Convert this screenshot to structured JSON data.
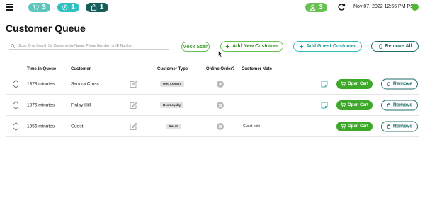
{
  "topbar": {
    "cart_count": "3",
    "pickup_count": "1",
    "bag_count": "1",
    "users_count": "3",
    "datetime": "Nov 07, 2022 12:56 PM PST",
    "colors": {
      "cart_pill": "#5cc6bd",
      "pickup_pill": "#2fc1c0",
      "bag_pill": "#175e5b",
      "users_pill": "#67c051",
      "status_dot": "#52b736"
    }
  },
  "page": {
    "title": "Customer Queue"
  },
  "toolbar": {
    "search_placeholder": "Scan ID or Search for Customer by Name, Phone Number, or ID Number",
    "mock_scan_label": "Mock Scan",
    "add_new_customer_label": "Add New Customer",
    "add_guest_customer_label": "Add Guest Customer",
    "remove_all_label": "Remove All"
  },
  "table": {
    "headers": {
      "time_in_queue": "Time in Queue",
      "customer": "Customer",
      "customer_type": "Customer Type",
      "online_order": "Online Order?",
      "customer_note": "Customer Note"
    },
    "rows": [
      {
        "time": "1378 minutes",
        "customer": "Sandra Cross",
        "type": "Med Loyalty",
        "note": "",
        "open_cart_label": "Open Cart",
        "remove_label": "Remove"
      },
      {
        "time": "1376 minutes",
        "customer": "Finlay Hill",
        "type": "Rec Loyalty",
        "note": "",
        "open_cart_label": "Open Cart",
        "remove_label": "Remove"
      },
      {
        "time": "1356 minutes",
        "customer": "Guest",
        "type": "Guest",
        "note": "Guest note",
        "open_cart_label": "Open Cart",
        "remove_label": "Remove"
      }
    ]
  },
  "icons": {
    "menu": "hamburger-icon",
    "cart": "cart-icon",
    "pickup": "pickup-icon",
    "bag": "bag-icon",
    "users": "user-icon",
    "refresh": "refresh-icon",
    "search": "search-icon",
    "plus": "plus-icon",
    "trash": "trash-icon",
    "reorder": "reorder-arrows-icon",
    "edit": "edit-icon",
    "offline": "x-circle-icon",
    "note": "note-icon"
  }
}
